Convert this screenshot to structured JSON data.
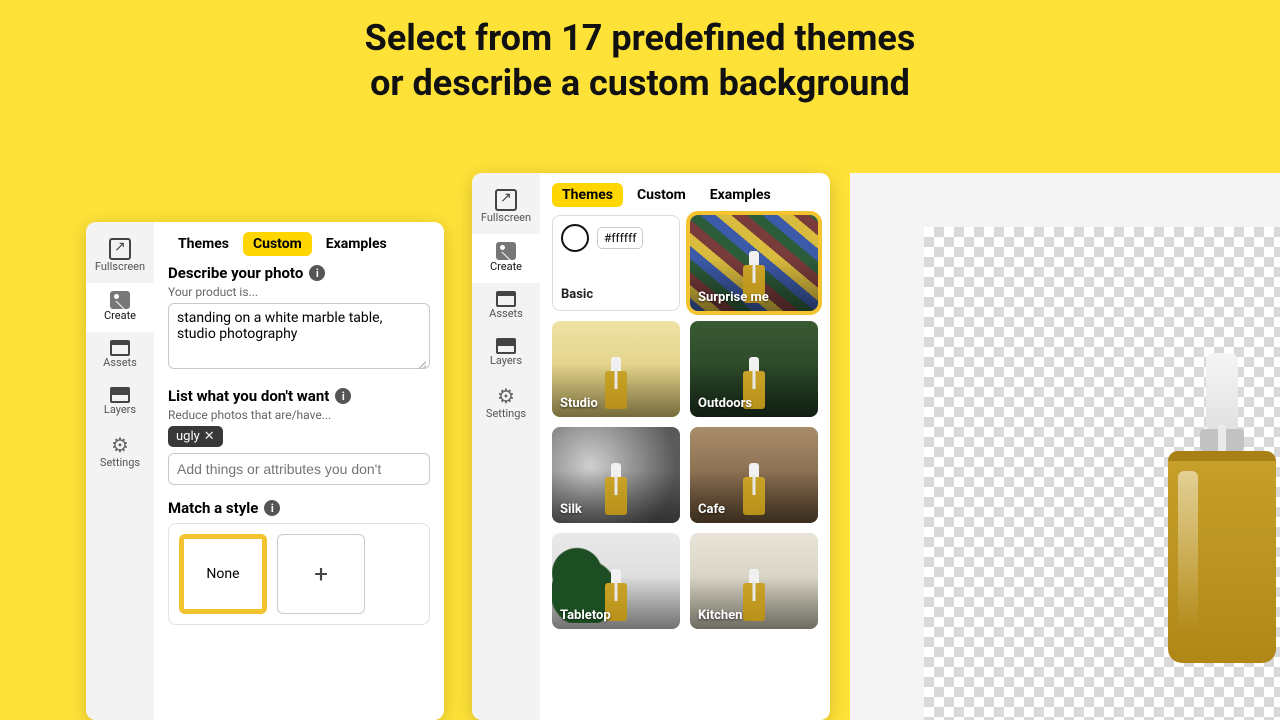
{
  "headline": {
    "line1": "Select from 17 predefined themes",
    "line2": "or describe a custom background"
  },
  "nav": {
    "fullscreen": "Fullscreen",
    "create": "Create",
    "assets": "Assets",
    "layers": "Layers",
    "settings": "Settings"
  },
  "tabs": {
    "themes": "Themes",
    "custom": "Custom",
    "examples": "Examples"
  },
  "panel1": {
    "describe_title": "Describe your photo",
    "describe_hint": "Your product is...",
    "describe_value": "standing on a white marble table, studio photography",
    "exclude_title": "List what you don't want",
    "exclude_hint": "Reduce photos that are/have...",
    "exclude_chip": "ugly",
    "exclude_placeholder": "Add things or attributes you don't",
    "style_title": "Match a style",
    "style_none": "None"
  },
  "panel2": {
    "basic_hex": "#ffffff",
    "basic_label": "Basic",
    "themes": {
      "surprise": "Surprise me",
      "studio": "Studio",
      "outdoors": "Outdoors",
      "silk": "Silk",
      "cafe": "Cafe",
      "tabletop": "Tabletop",
      "kitchen": "Kitchen"
    }
  }
}
